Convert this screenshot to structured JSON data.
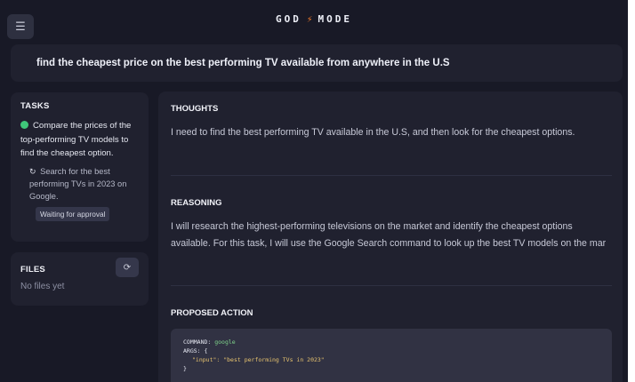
{
  "header": {
    "brand_left": "GOD",
    "brand_bolt": "⚡",
    "brand_right": "MODE",
    "menu_icon": "hamburger-menu-icon"
  },
  "goal": {
    "text": "find the cheapest price on the best performing TV available from anywhere in the U.S"
  },
  "tasks": {
    "heading": "TASKS",
    "main_task": "Compare the prices of the top-performing TV models to find the cheapest option.",
    "main_task_status_color": "#3fc77a",
    "subtask": "Search for the best performing TVs in 2023 on Google.",
    "subtask_icon": "spinner-icon",
    "subtask_status": "Waiting for approval"
  },
  "files": {
    "heading": "FILES",
    "empty_text": "No files yet",
    "refresh_icon": "refresh-icon"
  },
  "thoughts": {
    "title": "THOUGHTS",
    "text": "I need to find the best performing TV available in the U.S, and then look for the cheapest options."
  },
  "reasoning": {
    "title": "REASONING",
    "text": "I will research the highest-performing televisions on the market and identify the cheapest options available. For this task, I will use the Google Search command to look up the best TV models on the mar"
  },
  "proposed_action": {
    "title": "PROPOSED ACTION",
    "command_key": "COMMAND:",
    "command_value": "google",
    "args_key": "ARGS: {",
    "input_key": "\"input\":",
    "input_value": "\"best performing TVs in 2023\"",
    "close_brace": "}"
  },
  "colors": {
    "background": "#181926",
    "panel": "#20212f",
    "accent_bolt": "#f07a2a",
    "status_green": "#3fc77a"
  }
}
